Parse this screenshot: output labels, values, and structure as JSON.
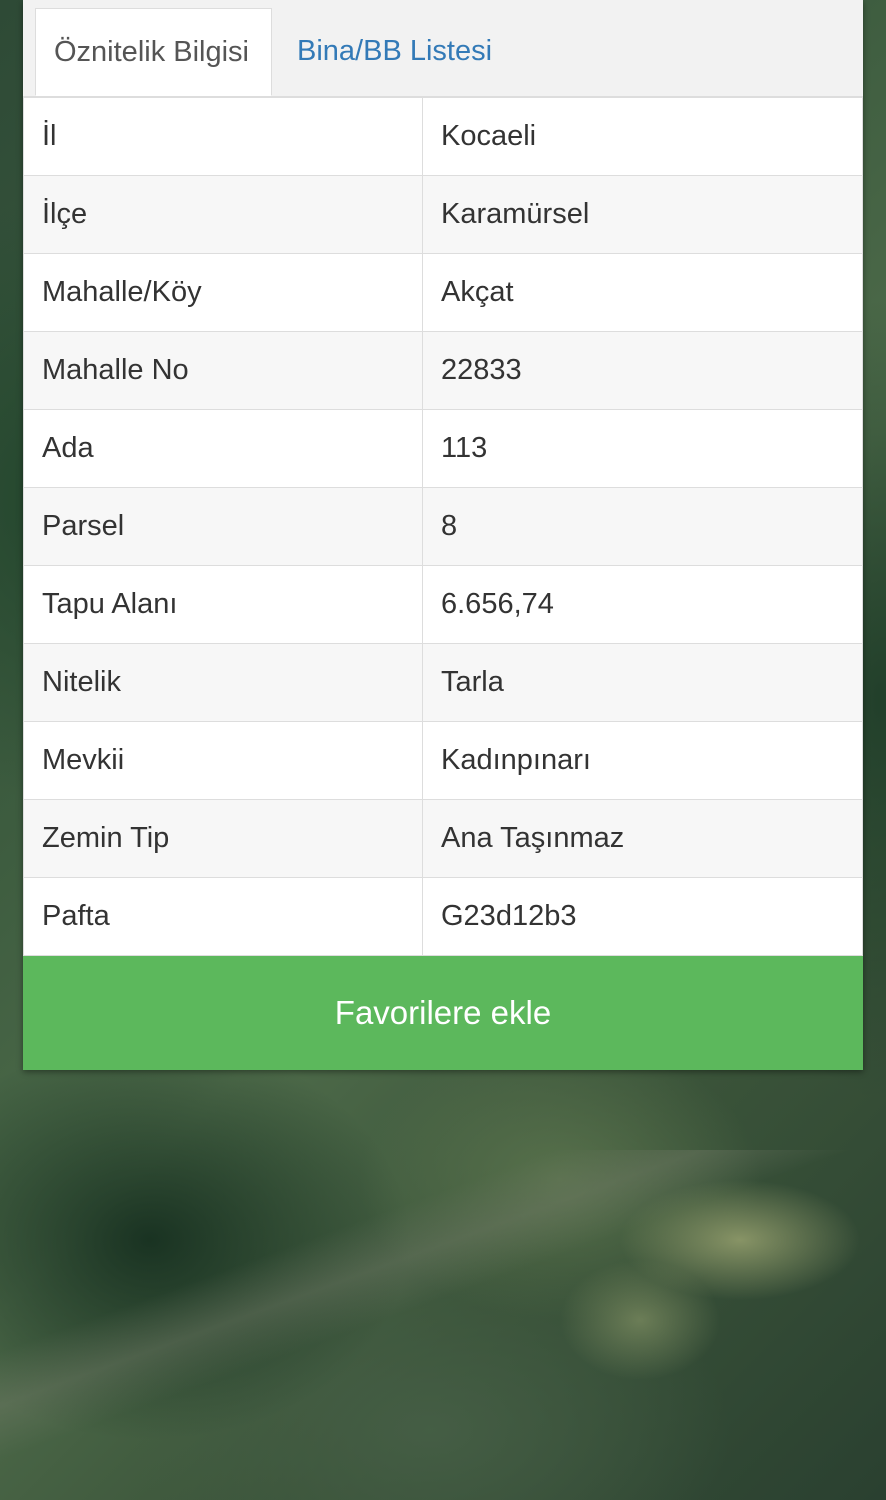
{
  "tabs": [
    {
      "label": "Öznitelik Bilgisi",
      "active": true
    },
    {
      "label": "Bina/BB Listesi",
      "active": false
    }
  ],
  "attributes": [
    {
      "key": "İl",
      "value": "Kocaeli"
    },
    {
      "key": "İlçe",
      "value": "Karamürsel"
    },
    {
      "key": "Mahalle/Köy",
      "value": "Akçat"
    },
    {
      "key": "Mahalle No",
      "value": "22833"
    },
    {
      "key": "Ada",
      "value": "113"
    },
    {
      "key": "Parsel",
      "value": "8"
    },
    {
      "key": "Tapu Alanı",
      "value": "6.656,74"
    },
    {
      "key": "Nitelik",
      "value": "Tarla"
    },
    {
      "key": "Mevkii",
      "value": "Kadınpınarı"
    },
    {
      "key": "Zemin Tip",
      "value": "Ana Taşınmaz"
    },
    {
      "key": "Pafta",
      "value": "G23d12b3"
    }
  ],
  "favorite_button": {
    "label": "Favorilere ekle"
  },
  "colors": {
    "tab_link": "#337ab7",
    "button_bg": "#5cb85c",
    "button_text": "#ffffff"
  }
}
